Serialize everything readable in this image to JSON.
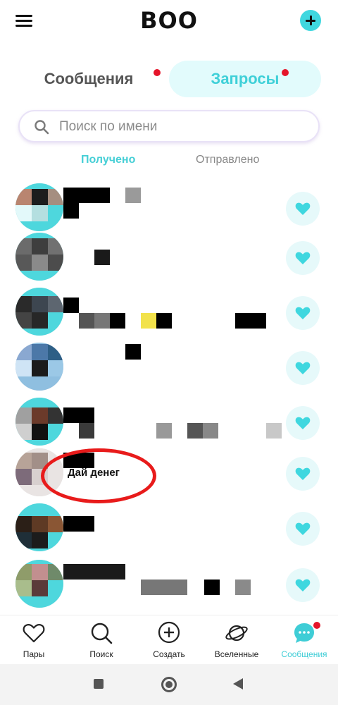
{
  "header": {
    "title": "BOO",
    "menu_icon": "hamburger-menu-icon",
    "add_icon": "plus-icon"
  },
  "tabs": [
    {
      "label": "Сообщения",
      "has_badge": true
    },
    {
      "label": "Запросы",
      "has_badge": true,
      "active": true
    }
  ],
  "search": {
    "placeholder": "Поиск по имени",
    "value": ""
  },
  "subtabs": [
    {
      "label": "Получено",
      "active": true
    },
    {
      "label": "Отправлено",
      "active": false
    }
  ],
  "requests": [
    {
      "preview_text": "",
      "action_icon": "heart-icon"
    },
    {
      "preview_text": "",
      "action_icon": "heart-icon"
    },
    {
      "preview_text": "",
      "action_icon": "heart-icon"
    },
    {
      "preview_text": "",
      "action_icon": "heart-icon"
    },
    {
      "preview_text": "",
      "action_icon": "heart-icon"
    },
    {
      "preview_text": "Дай денег",
      "action_icon": "heart-icon"
    },
    {
      "preview_text": "",
      "action_icon": "heart-icon"
    },
    {
      "preview_text": "",
      "action_icon": "heart-icon"
    }
  ],
  "bottom_nav": [
    {
      "label": "Пары",
      "icon": "heart-outline-icon"
    },
    {
      "label": "Поиск",
      "icon": "search-icon"
    },
    {
      "label": "Создать",
      "icon": "plus-circle-icon"
    },
    {
      "label": "Вселенные",
      "icon": "planet-icon"
    },
    {
      "label": "Сообщения",
      "icon": "chat-bubble-icon",
      "active": true,
      "has_badge": true
    }
  ],
  "colors": {
    "accent": "#3fd7df",
    "accent_light": "#e2fbfc",
    "badge": "#e5152a",
    "highlight_ring": "#e81b1b"
  }
}
